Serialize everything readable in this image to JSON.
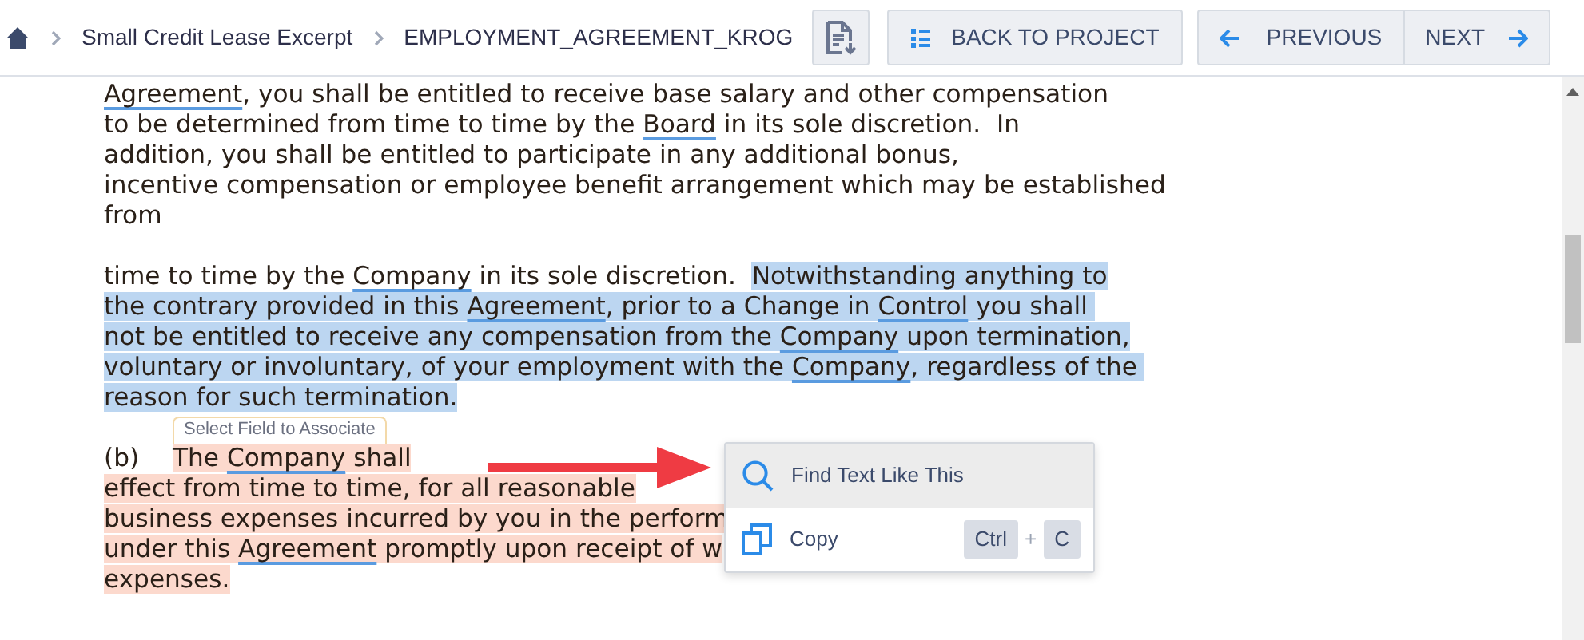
{
  "breadcrumb": [
    "Small Credit Lease Excerpt",
    "EMPLOYMENT_AGREEMENT_KROG"
  ],
  "toolbar": {
    "back_button": "BACK TO PROJECT",
    "previous_button": "PREVIOUS",
    "next_button": "NEXT"
  },
  "document": {
    "lines": [
      {
        "kind": "text",
        "segments": [
          {
            "text": "Agreement",
            "term": true
          },
          {
            "text": ", you shall be entitled to receive base salary and other compensation"
          }
        ]
      },
      {
        "kind": "text",
        "segments": [
          {
            "text": "to be determined from time to time by the "
          },
          {
            "text": "Board",
            "term": true
          },
          {
            "text": " in its sole discretion.  In"
          }
        ]
      },
      {
        "kind": "text",
        "segments": [
          {
            "text": "addition, you shall be entitled to participate in any additional bonus,"
          }
        ]
      },
      {
        "kind": "text",
        "segments": [
          {
            "text": "incentive compensation or employee benefit arrangement which may be established"
          }
        ]
      },
      {
        "kind": "text",
        "segments": [
          {
            "text": "from"
          }
        ]
      },
      {
        "kind": "blank"
      },
      {
        "kind": "text",
        "segments": [
          {
            "text": "time to time by the "
          },
          {
            "text": "Company",
            "term": true
          },
          {
            "text": " in its sole discretion.  "
          },
          {
            "text": "Notwithstanding anything to",
            "color": "#bcd6f1"
          }
        ]
      },
      {
        "kind": "text",
        "segments": [
          {
            "text": "the contrary provided in this ",
            "color": "#bcd6f1"
          },
          {
            "text": "Agreement",
            "term": true,
            "color": "#bcd6f1"
          },
          {
            "text": ", prior to a Change in ",
            "color": "#bcd6f1"
          },
          {
            "text": "Control",
            "term": true,
            "color": "#bcd6f1"
          },
          {
            "text": " you shall ",
            "color": "#bcd6f1"
          }
        ]
      },
      {
        "kind": "text",
        "segments": [
          {
            "text": "not be entitled to receive any compensation from the ",
            "color": "#bcd6f1"
          },
          {
            "text": "Company",
            "term": true,
            "color": "#bcd6f1"
          },
          {
            "text": " upon termination,",
            "color": "#bcd6f1"
          }
        ]
      },
      {
        "kind": "text",
        "segments": [
          {
            "text": "voluntary or involuntary, of your employment with the ",
            "color": "#bcd6f1"
          },
          {
            "text": "Company",
            "term": true,
            "color": "#bcd6f1"
          },
          {
            "text": ", regardless of the ",
            "color": "#bcd6f1"
          }
        ]
      },
      {
        "kind": "text",
        "segments": [
          {
            "text": "reason for such termination.",
            "color": "#bcd6f1"
          }
        ]
      },
      {
        "kind": "tag",
        "text": "Select Field to Associate"
      },
      {
        "kind": "text",
        "number": "(b)",
        "segments": [
          {
            "text": "The ",
            "color": "#fcd9cd"
          },
          {
            "text": "Company",
            "term": true,
            "color": "#fcd9cd"
          },
          {
            "text": " shall",
            "color": "#fcd9cd"
          }
        ]
      },
      {
        "kind": "text",
        "segments": [
          {
            "text": "effect from time to time, for all reasonable",
            "color": "#fcd9cd"
          }
        ]
      },
      {
        "kind": "text",
        "segments": [
          {
            "text": "business expenses incurred by you in the perform",
            "color": "#fcd9cd"
          }
        ]
      },
      {
        "kind": "text",
        "segments": [
          {
            "text": "under this ",
            "color": "#fcd9cd"
          },
          {
            "text": "Agreement",
            "term": true,
            "color": "#fcd9cd"
          },
          {
            "text": " promptly upon receipt of w",
            "color": "#fcd9cd"
          }
        ]
      },
      {
        "kind": "text",
        "segments": [
          {
            "text": "expenses.",
            "color": "#fcd9cd"
          }
        ]
      }
    ]
  },
  "context_menu": {
    "items": [
      {
        "kind": "search",
        "label": "Find Text Like This",
        "selected": true
      },
      {
        "kind": "copy",
        "label": "Copy",
        "selected": false,
        "shortcut": {
          "keys": [
            "Ctrl",
            "C"
          ],
          "joiner": "+"
        }
      }
    ]
  }
}
